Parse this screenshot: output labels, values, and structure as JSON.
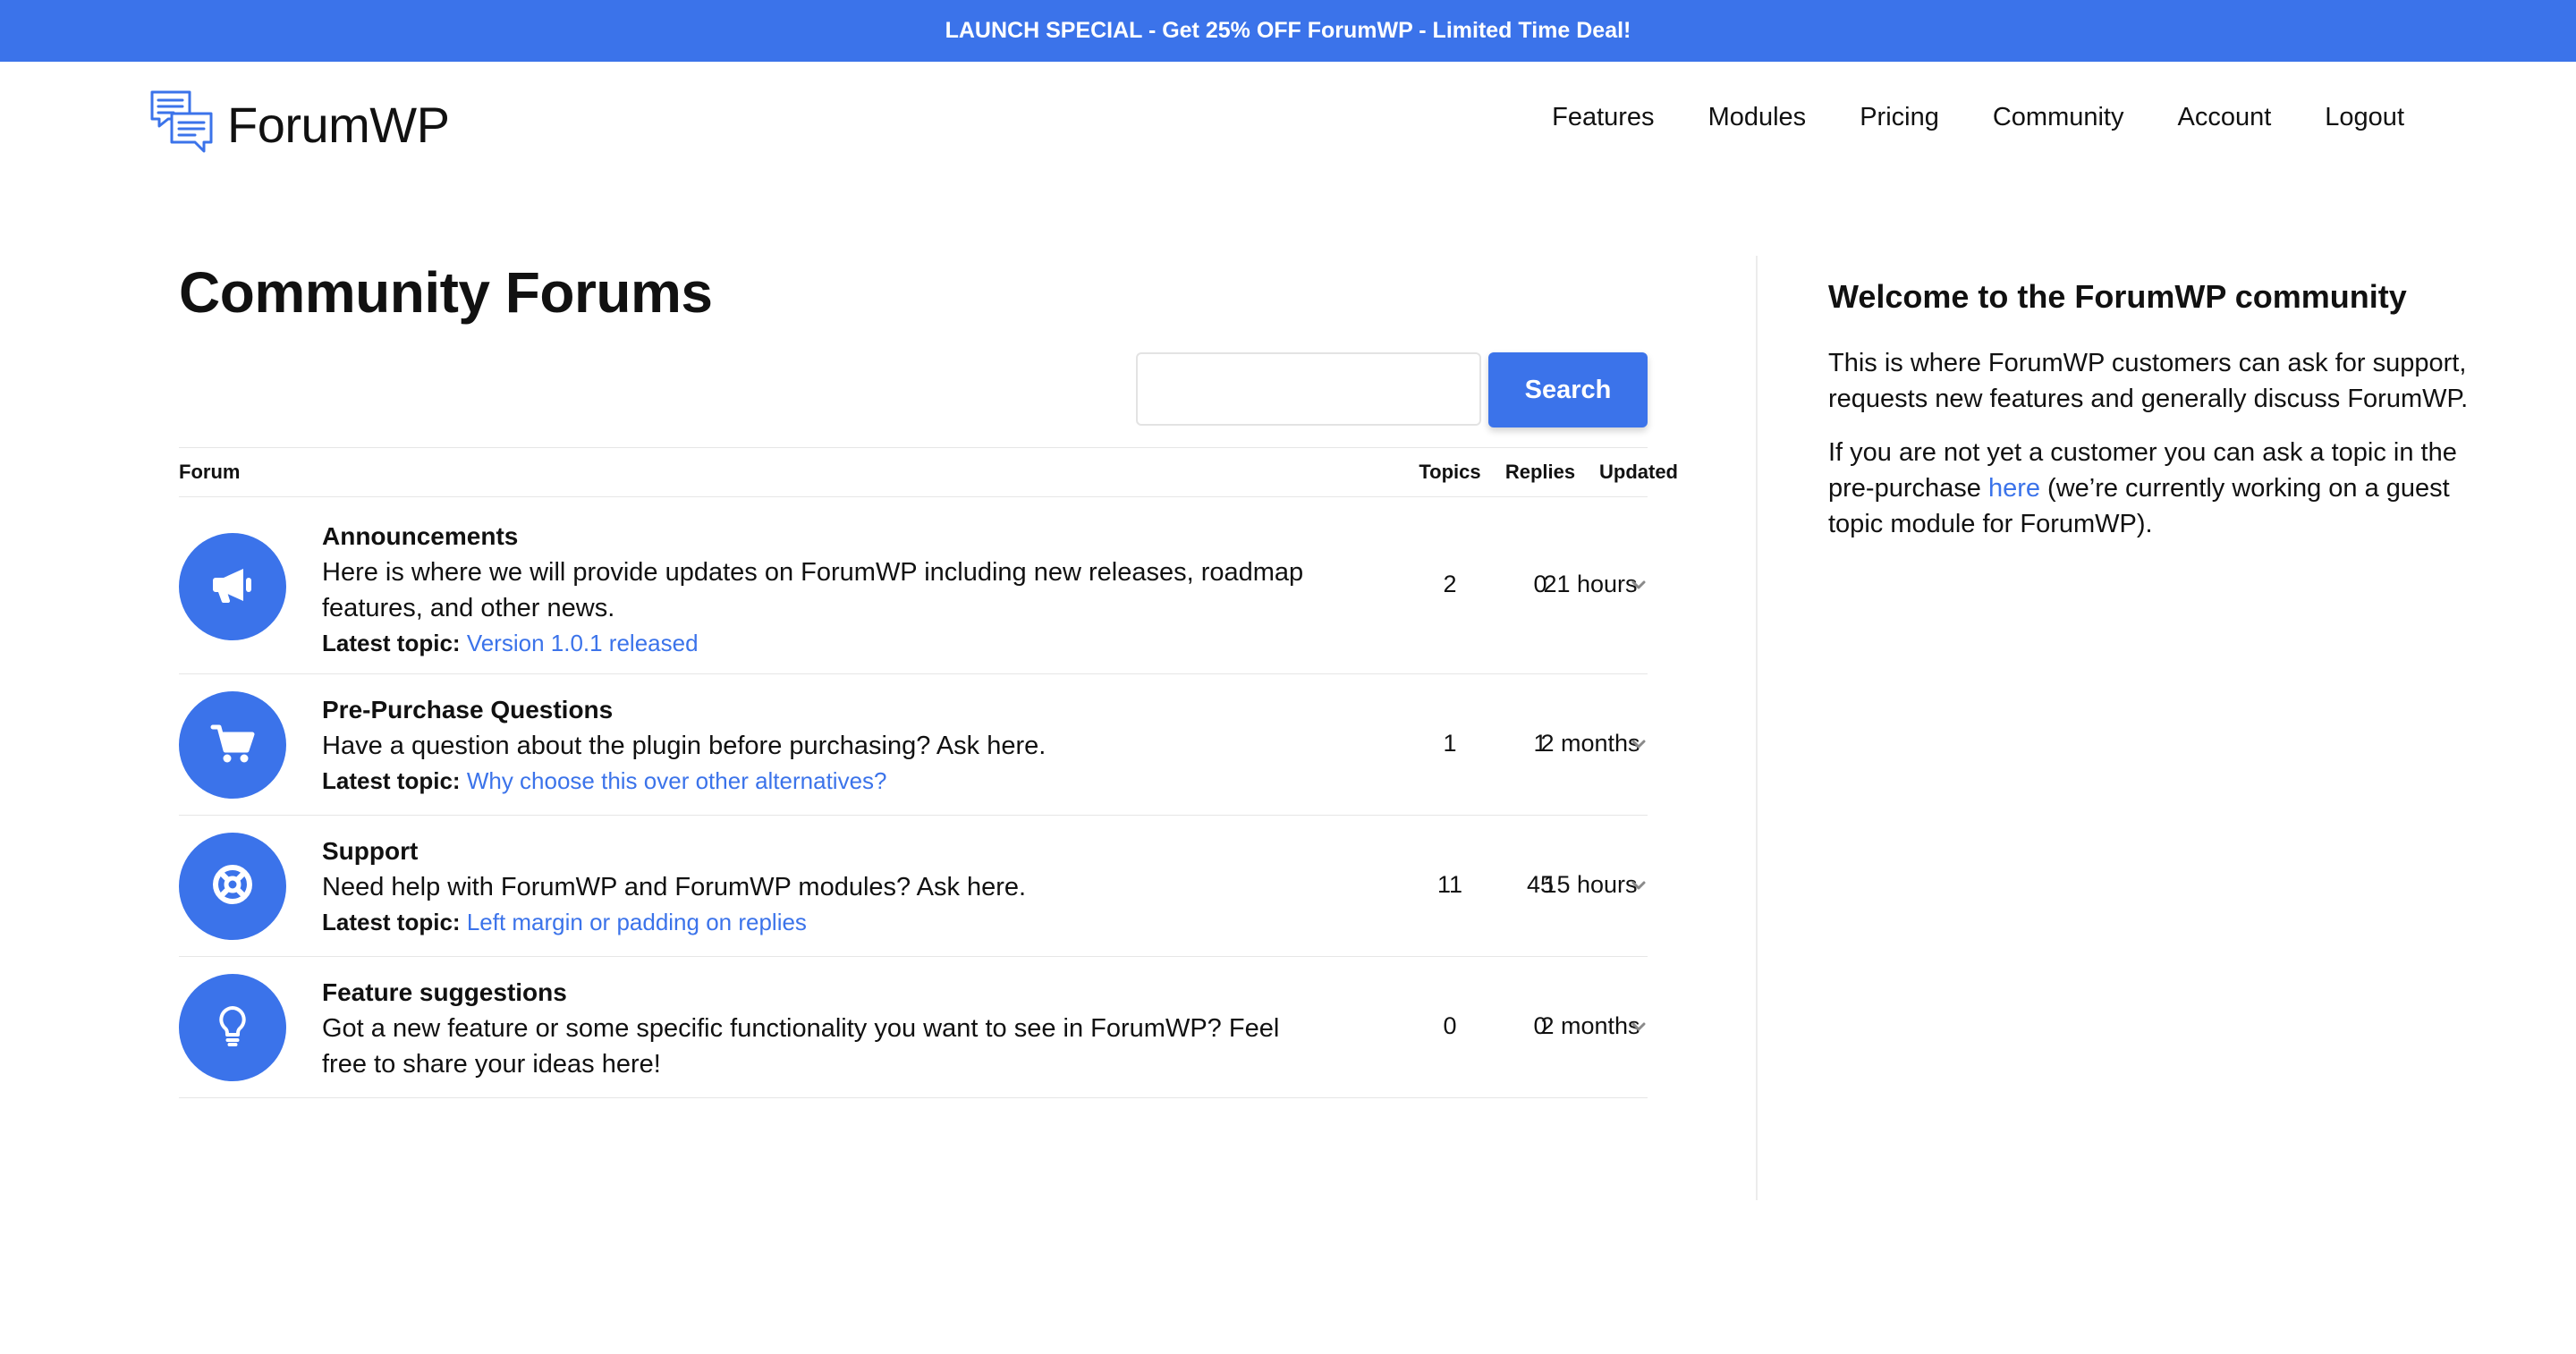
{
  "promo": {
    "text": "LAUNCH SPECIAL - Get 25% OFF ForumWP - Limited Time Deal!"
  },
  "header": {
    "logo_text": "ForumWP",
    "nav": [
      "Features",
      "Modules",
      "Pricing",
      "Community",
      "Account",
      "Logout"
    ]
  },
  "main": {
    "title": "Community Forums",
    "search": {
      "button_label": "Search",
      "value": ""
    },
    "table": {
      "headers": {
        "forum": "Forum",
        "topics": "Topics",
        "replies": "Replies",
        "updated": "Updated"
      },
      "latest_label": "Latest topic:",
      "rows": [
        {
          "name": "Announcements",
          "description": "Here is where we will provide updates on ForumWP including new releases, roadmap features, and other news.",
          "latest_topic": "Version 1.0.1 released",
          "topics": "2",
          "replies": "0",
          "updated": "21 hours",
          "icon": "megaphone-icon"
        },
        {
          "name": "Pre-Purchase Questions",
          "description": "Have a question about the plugin before purchasing? Ask here.",
          "latest_topic": "Why choose this over other alternatives?",
          "topics": "1",
          "replies": "1",
          "updated": "2 months",
          "icon": "cart-icon"
        },
        {
          "name": "Support",
          "description": "Need help with ForumWP and ForumWP modules? Ask here.",
          "latest_topic": "Left margin or padding on replies",
          "topics": "11",
          "replies": "45",
          "updated": "15 hours",
          "icon": "lifebuoy-icon"
        },
        {
          "name": "Feature suggestions",
          "description": "Got a new feature or some specific functionality you want to see in ForumWP? Feel free to share your ideas here!",
          "latest_topic": "",
          "topics": "0",
          "replies": "0",
          "updated": "2 months",
          "icon": "lightbulb-icon"
        }
      ]
    }
  },
  "sidebar": {
    "title": "Welcome to the ForumWP community",
    "paragraph1": "This is where ForumWP customers can ask for support, requests new features and generally discuss ForumWP.",
    "paragraph2_before": "If you are not yet a customer you can ask a topic in the pre-purchase ",
    "paragraph2_link": "here",
    "paragraph2_after": " (we’re currently working on a guest topic module for ForumWP)."
  },
  "colors": {
    "accent": "#3b73ea",
    "text": "#111111",
    "border": "#e6e6e6"
  }
}
